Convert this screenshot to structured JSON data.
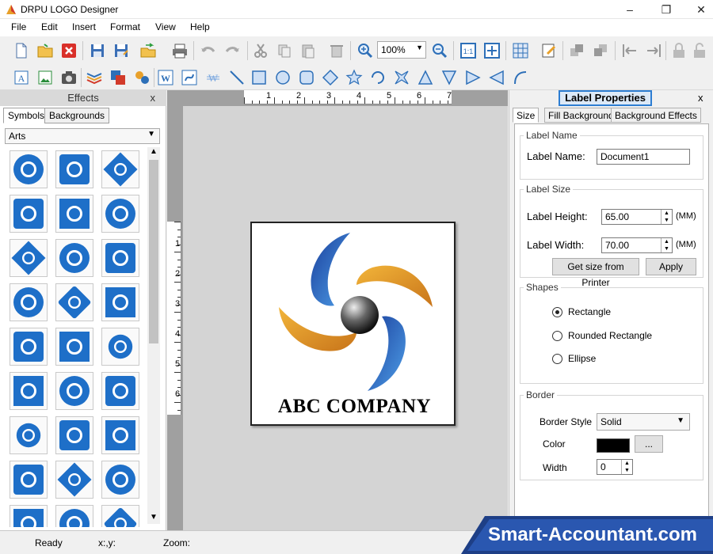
{
  "window": {
    "title": "DRPU LOGO Designer",
    "minimize": "–",
    "maximize": "❐",
    "close": "✕"
  },
  "menu": [
    "File",
    "Edit",
    "Insert",
    "Format",
    "View",
    "Help"
  ],
  "toolbar": {
    "zoom": "100%"
  },
  "effects_panel": {
    "title": "Effects",
    "close": "x",
    "tabs": [
      "Symbols",
      "Backgrounds"
    ],
    "category": "Arts"
  },
  "canvas": {
    "ruler_top": [
      "1",
      "2",
      "3",
      "4",
      "5",
      "6",
      "7"
    ],
    "ruler_left": [
      "1",
      "2",
      "3",
      "4",
      "5",
      "6"
    ],
    "label_text": "ABC COMPANY"
  },
  "properties": {
    "title": "Label Properties",
    "close": "x",
    "tabs": [
      "Size",
      "Fill Background",
      "Background Effects"
    ],
    "label_name_group": "Label Name",
    "label_name_label": "Label Name:",
    "label_name_value": "Document1",
    "label_size_group": "Label Size",
    "height_label": "Label Height:",
    "height_value": "65.00",
    "height_unit": "(MM)",
    "width_label": "Label Width:",
    "width_value": "70.00",
    "width_unit": "(MM)",
    "get_size_button": "Get size from Printer",
    "apply_button": "Apply",
    "shapes_group": "Shapes",
    "shape_rect": "Rectangle",
    "shape_rounded": "Rounded Rectangle",
    "shape_ellipse": "Ellipse",
    "border_group": "Border",
    "border_style_label": "Border Style",
    "border_style_value": "Solid",
    "color_label": "Color",
    "color_button": "...",
    "border_color": "#000000",
    "width_label2": "Width",
    "border_width_value": "0"
  },
  "status": {
    "ready": "Ready",
    "coords": "x:,y:",
    "zoom": "Zoom:"
  },
  "watermark": "Smart-Accountant.com"
}
